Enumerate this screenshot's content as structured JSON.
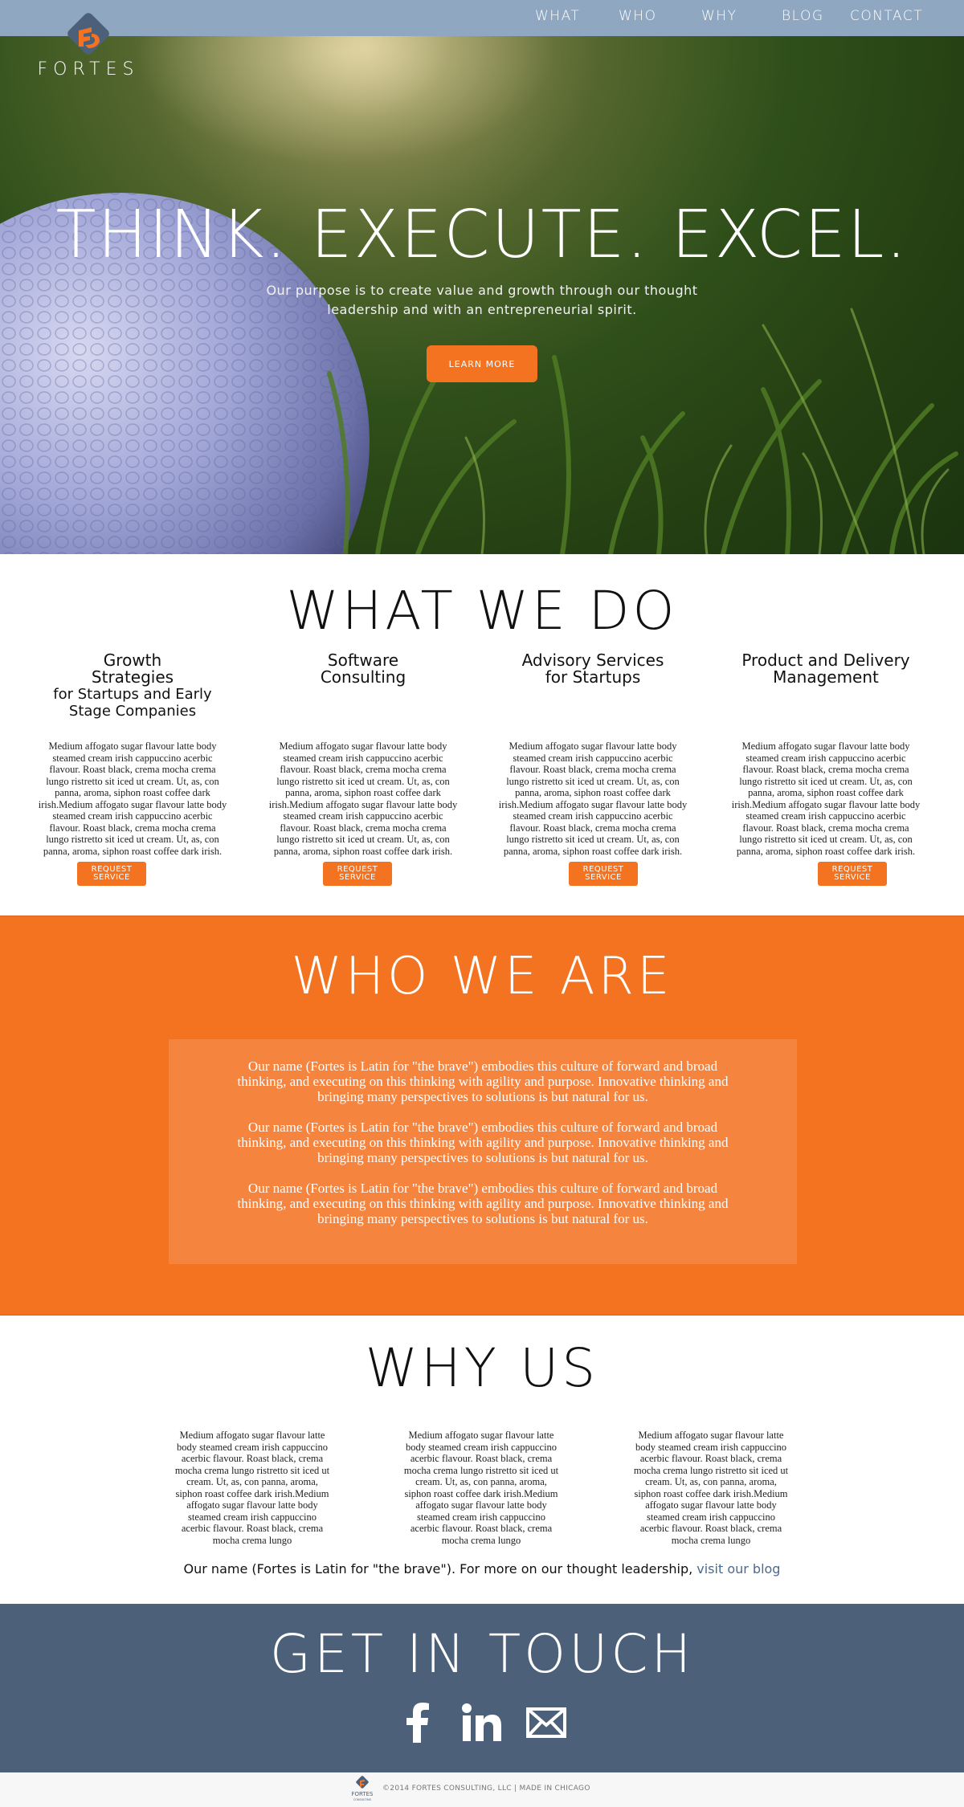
{
  "nav": {
    "items": [
      {
        "label": "WHAT"
      },
      {
        "label": "WHO"
      },
      {
        "label": "WHY"
      },
      {
        "label": "BLOG"
      },
      {
        "label": "CONTACT"
      }
    ]
  },
  "brand": {
    "name": "FORTES",
    "icon": "fortes-f-diamond-icon",
    "accent": "#f47321",
    "dark": "#4c6179"
  },
  "hero": {
    "title": "THINK. EXECUTE. EXCEL.",
    "subtitle": "Our purpose is to create value and growth through our thought leadership and with an entrepreneurial spirit.",
    "button": "LEARN MORE"
  },
  "what": {
    "heading": "WHAT WE DO",
    "services": [
      {
        "title": "Growth Strategies",
        "title2": "for Startups and Early Stage Companies",
        "body": "Medium affogato sugar flavour latte body steamed cream irish cappuccino acerbic flavour. Roast black, crema mocha crema lungo ristretto sit iced ut cream. Ut, as, con panna, aroma, siphon roast coffee dark irish.Medium affogato sugar flavour latte body steamed cream irish cappuccino acerbic flavour. Roast black, crema mocha crema lungo ristretto sit iced ut cream. Ut, as, con panna, aroma, siphon roast coffee dark irish.",
        "button": "REQUEST SERVICE"
      },
      {
        "title": "Software Consulting",
        "title2": "",
        "body": "Medium affogato sugar flavour latte body steamed cream irish cappuccino acerbic flavour. Roast black, crema mocha crema lungo ristretto sit iced ut cream. Ut, as, con panna, aroma, siphon roast coffee dark irish.Medium affogato sugar flavour latte body steamed cream irish cappuccino acerbic flavour. Roast black, crema mocha crema lungo ristretto sit iced ut cream. Ut, as, con panna, aroma, siphon roast coffee dark irish.",
        "button": "REQUEST SERVICE"
      },
      {
        "title": "Advisory Services for Startups",
        "title2": "",
        "body": "Medium affogato sugar flavour latte body steamed cream irish cappuccino acerbic flavour. Roast black, crema mocha crema lungo ristretto sit iced ut cream. Ut, as, con panna, aroma, siphon roast coffee dark irish.Medium affogato sugar flavour latte body steamed cream irish cappuccino acerbic flavour. Roast black, crema mocha crema lungo ristretto sit iced ut cream. Ut, as, con panna, aroma, siphon roast coffee dark irish.",
        "button": "REQUEST SERVICE"
      },
      {
        "title": "Product and Delivery Management",
        "title2": "",
        "body": "Medium affogato sugar flavour latte body steamed cream irish cappuccino acerbic flavour. Roast black, crema mocha crema lungo ristretto sit iced ut cream. Ut, as, con panna, aroma, siphon roast coffee dark irish.Medium affogato sugar flavour latte body steamed cream irish cappuccino acerbic flavour. Roast black, crema mocha crema lungo ristretto sit iced ut cream. Ut, as, con panna, aroma, siphon roast coffee dark irish.",
        "button": "REQUEST SERVICE"
      }
    ]
  },
  "who": {
    "heading": "WHO WE ARE",
    "paragraphs": [
      "Our name (Fortes is Latin for \"the brave\") embodies this culture of forward and broad thinking, and executing on this thinking with agility and purpose. Innovative thinking and bringing many perspectives to solutions is but natural for us.",
      "Our name (Fortes is Latin for \"the brave\") embodies this culture of forward and broad thinking, and executing on this thinking with agility and purpose. Innovative thinking and bringing many perspectives to solutions is but natural for us.",
      "Our name (Fortes is Latin for \"the brave\") embodies this culture of forward and broad thinking, and executing on this thinking with agility and purpose. Innovative thinking and bringing many perspectives to solutions is but natural for us."
    ]
  },
  "why": {
    "heading": "WHY US",
    "columns": [
      "Medium affogato sugar flavour latte body steamed cream irish cappuccino acerbic flavour. Roast black, crema mocha crema lungo ristretto sit iced ut cream. Ut, as, con panna, aroma, siphon roast coffee dark irish.Medium affogato sugar flavour latte body steamed cream irish cappuccino acerbic flavour. Roast black, crema mocha crema lungo",
      "Medium affogato sugar flavour latte body steamed cream irish cappuccino acerbic flavour. Roast black, crema mocha crema lungo ristretto sit iced ut cream. Ut, as, con panna, aroma, siphon roast coffee dark irish.Medium affogato sugar flavour latte body steamed cream irish cappuccino acerbic flavour. Roast black, crema mocha crema lungo",
      "Medium affogato sugar flavour latte body steamed cream irish cappuccino acerbic flavour. Roast black, crema mocha crema lungo ristretto sit iced ut cream. Ut, as, con panna, aroma, siphon roast coffee dark irish.Medium affogato sugar flavour latte body steamed cream irish cappuccino acerbic flavour. Roast black, crema mocha crema lungo"
    ],
    "tagline": "Our name (Fortes is Latin for \"the brave\"). For more on our thought leadership, ",
    "link": "visit our blog"
  },
  "touch": {
    "heading": "GET IN TOUCH",
    "social": [
      {
        "icon": "facebook-icon"
      },
      {
        "icon": "linkedin-icon"
      },
      {
        "icon": "mail-icon"
      }
    ]
  },
  "footer": {
    "text": "©2014 FORTES CONSULTING, LLC | MADE IN CHICAGO",
    "logo_text": "FORTES",
    "logo_sub": "CONSULTING"
  }
}
